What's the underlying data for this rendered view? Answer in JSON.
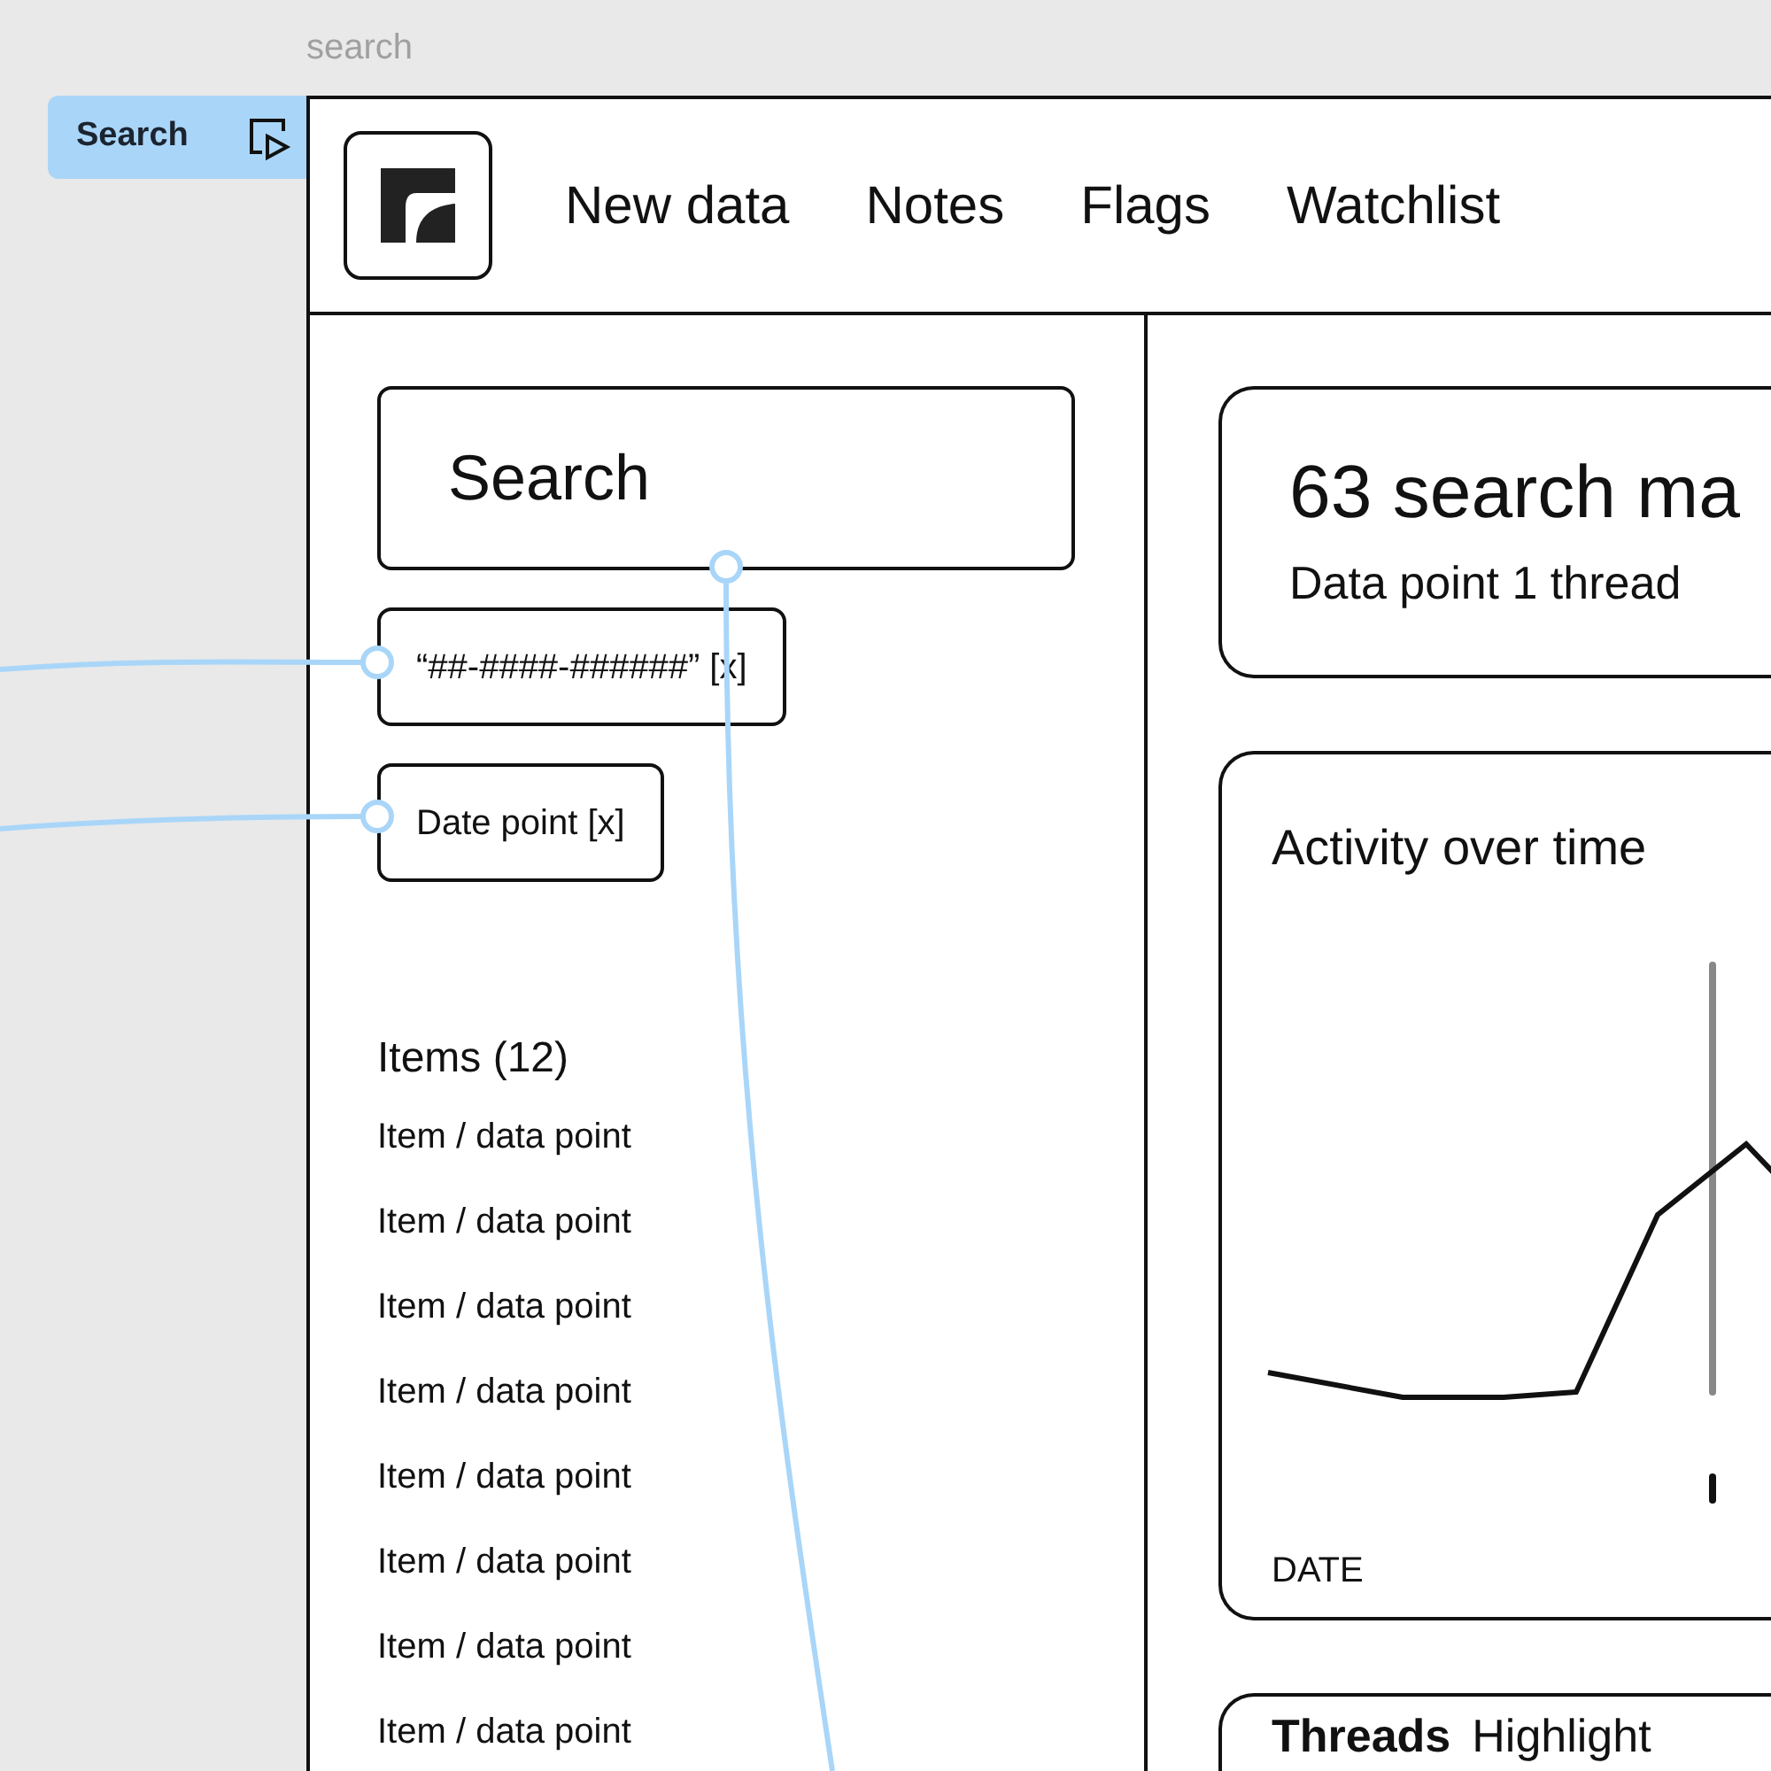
{
  "canvas": {
    "frame_label": "search",
    "flow_tag": "Search"
  },
  "nav": [
    "New data",
    "Notes",
    "Flags",
    "Watchlist"
  ],
  "search": {
    "placeholder": "Search"
  },
  "filters": [
    "“##-####-######” [x]",
    "Date point [x]"
  ],
  "items": {
    "heading": "Items (12)",
    "rows": [
      "Item / data point",
      "Item / data point",
      "Item / data point",
      "Item / data point",
      "Item / data point",
      "Item / data point",
      "Item / data point",
      "Item / data point"
    ]
  },
  "summary": {
    "title": "63 search ma",
    "subtitle": "Data point 1 thread"
  },
  "activity": {
    "title": "Activity over time",
    "axis_label": "DATE"
  },
  "threads": {
    "title": "Threads",
    "subtitle": "Highlight"
  }
}
